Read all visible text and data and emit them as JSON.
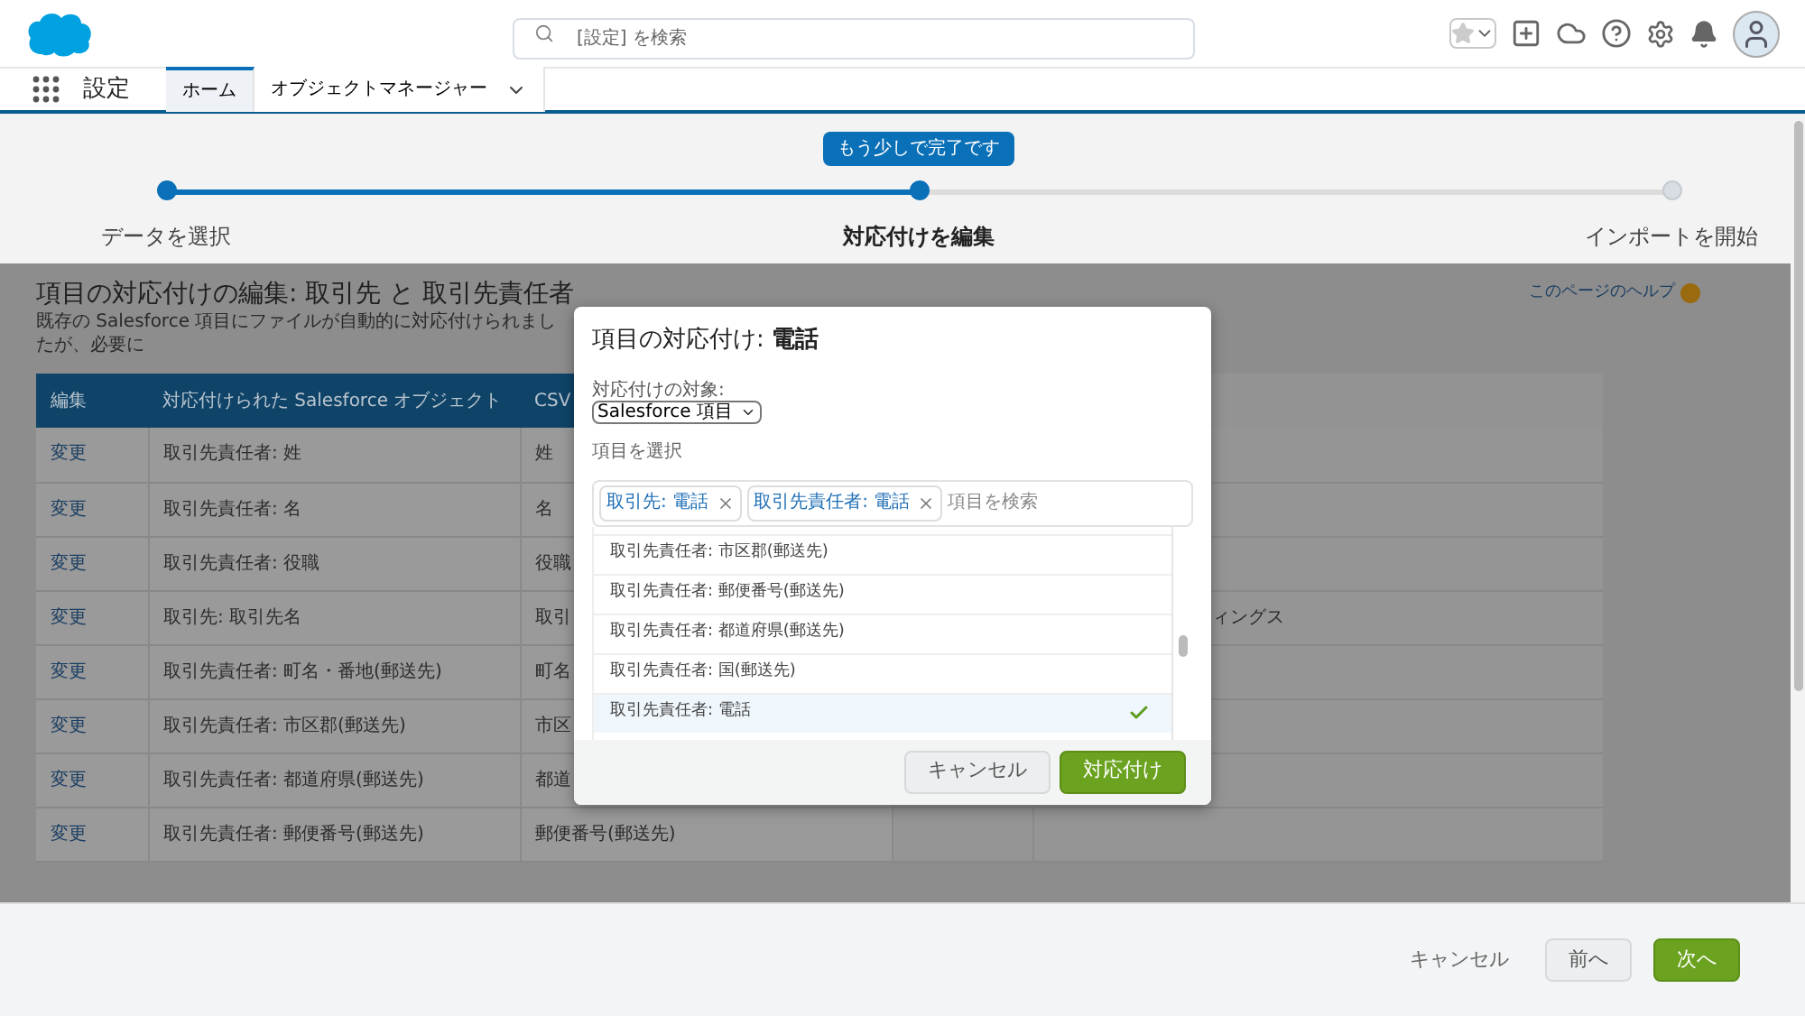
{
  "header": {
    "search": {
      "placeholder": "[設定] を検索"
    }
  },
  "nav": {
    "app_title": "設定",
    "tabs": [
      {
        "label": "ホーム",
        "selected": true,
        "has_menu": false
      },
      {
        "label": "オブジェクトマネージャー",
        "selected": false,
        "has_menu": true
      }
    ]
  },
  "progress": {
    "tooltip": "もう少しで完了です",
    "steps": [
      {
        "label": "データを選択",
        "completed": true,
        "selected": false
      },
      {
        "label": "対応付けを編集",
        "completed": true,
        "selected": true
      },
      {
        "label": "インポートを開始",
        "completed": false,
        "selected": false
      }
    ]
  },
  "page": {
    "title": "項目の対応付けの編集: 取引先 と 取引先責任者",
    "subtitle": "既存の Salesforce 項目にファイルが自動的に対応付けられましたが、必要に",
    "help_link": "このページのヘルプ"
  },
  "table": {
    "columns": [
      "編集",
      "対応付けられた Salesforce オブジェクト",
      "CSV"
    ],
    "rows": [
      {
        "action": "変更",
        "object": "取引先責任者: 姓",
        "csv": "姓"
      },
      {
        "action": "変更",
        "object": "取引先責任者: 名",
        "csv": "名"
      },
      {
        "action": "変更",
        "object": "取引先責任者: 役職",
        "csv": "役職"
      },
      {
        "action": "変更",
        "object": "取引先: 取引先名",
        "csv": "取引",
        "column_4": "ィングス"
      },
      {
        "action": "変更",
        "object": "取引先責任者: 町名・番地(郵送先)",
        "csv": "町名"
      },
      {
        "action": "変更",
        "object": "取引先責任者: 市区郡(郵送先)",
        "csv": "市区"
      },
      {
        "action": "変更",
        "object": "取引先責任者: 都道府県(郵送先)",
        "csv": "都道"
      },
      {
        "action": "変更",
        "object": "取引先責任者: 郵便番号(郵送先)",
        "csv": "郵便番号(郵送先)"
      }
    ]
  },
  "modal": {
    "title": "項目の対応付け: **電話**",
    "target_label": "対応付けの対象:",
    "target_value": "Salesforce 項目",
    "select_label": "項目を選択",
    "pills": [
      "取引先: 電話",
      "取引先責任者: 電話"
    ],
    "search_placeholder": "項目を検索",
    "options": [
      {
        "label": "取引先責任者: 市区郡(郵送先)",
        "selected": false
      },
      {
        "label": "取引先責任者: 郵便番号(郵送先)",
        "selected": false
      },
      {
        "label": "取引先責任者: 都道府県(郵送先)",
        "selected": false
      },
      {
        "label": "取引先責任者: 国(郵送先)",
        "selected": false
      },
      {
        "label": "取引先責任者: 電話",
        "selected": true
      }
    ],
    "buttons": [
      {
        "label": "キャンセル",
        "kind": "secondary"
      },
      {
        "label": "対応付け",
        "kind": "primary"
      }
    ]
  },
  "footer": {
    "buttons": [
      {
        "label": "キャンセル",
        "kind": "link"
      },
      {
        "label": "前へ",
        "kind": "secondary"
      },
      {
        "label": "次へ",
        "kind": "primary"
      }
    ]
  }
}
